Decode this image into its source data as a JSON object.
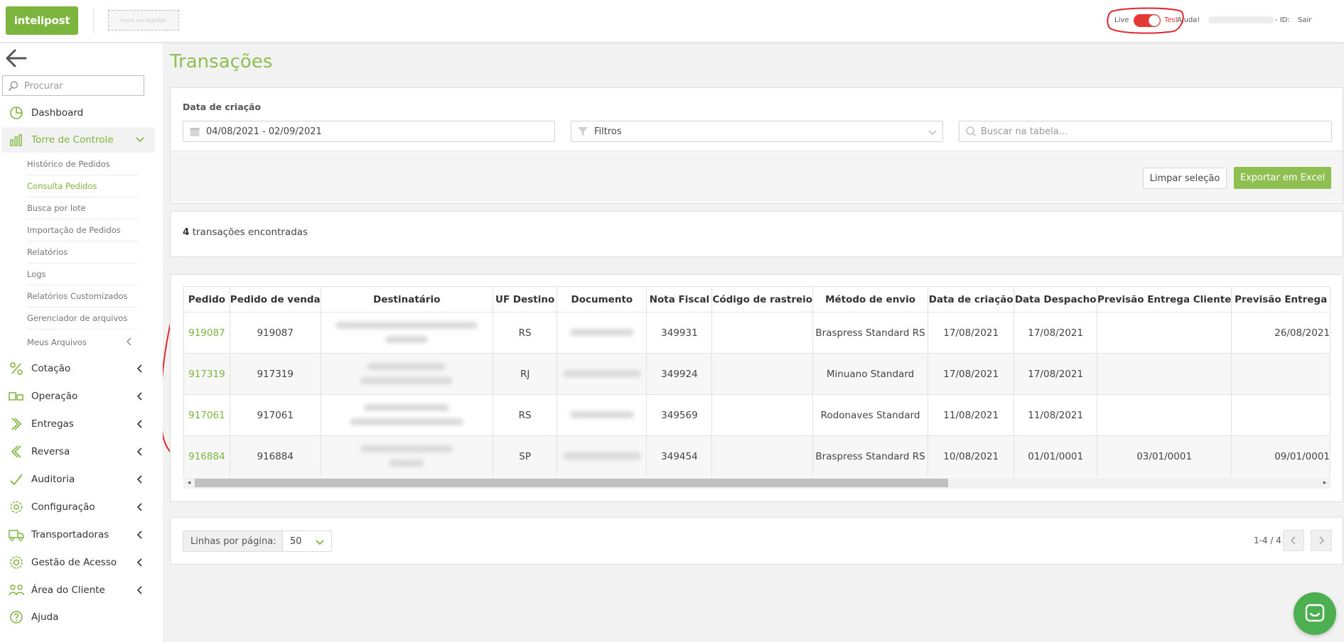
{
  "header": {
    "logo_text": "intelipost",
    "logo_placeholder": "Insira seu logotipo",
    "env_live": "Live",
    "env_test": "Test",
    "help": "Ajuda!",
    "id_label": "- ID:",
    "logout": "Sair"
  },
  "sidebar": {
    "search_placeholder": "Procurar",
    "items": [
      {
        "label": "Dashboard",
        "icon": "pie-chart-icon"
      },
      {
        "label": "Torre de Controle",
        "icon": "bar-chart-icon"
      },
      {
        "label": "Cotação",
        "icon": "percent-icon"
      },
      {
        "label": "Operação",
        "icon": "truck-box-icon"
      },
      {
        "label": "Entregas",
        "icon": "chevrons-right-icon"
      },
      {
        "label": "Reversa",
        "icon": "chevrons-left-icon"
      },
      {
        "label": "Auditoria",
        "icon": "checkmark-icon"
      },
      {
        "label": "Configuração",
        "icon": "gear-icon"
      },
      {
        "label": "Transportadoras",
        "icon": "truck-icon"
      },
      {
        "label": "Gestão de Acesso",
        "icon": "cog-lock-icon"
      },
      {
        "label": "Área do Cliente",
        "icon": "users-icon"
      },
      {
        "label": "Ajuda",
        "icon": "question-icon"
      }
    ],
    "subitems": [
      "Histórico de Pedidos",
      "Consulta Pedidos",
      "Busca por lote",
      "Importação de Pedidos",
      "Relatórios",
      "Logs",
      "Relatórios Customizados",
      "Gerenciador de arquivos",
      "Meus Arquivos"
    ]
  },
  "page": {
    "title": "Transações",
    "filters": {
      "label": "Data de criação",
      "date_range": "04/08/2021 - 02/09/2021",
      "filters_placeholder": "Filtros",
      "search_placeholder": "Buscar na tabela..."
    },
    "buttons": {
      "clear": "Limpar seleção",
      "export": "Exportar em Excel"
    },
    "results": {
      "count": "4",
      "suffix": " transações encontradas"
    },
    "table": {
      "columns": [
        "Pedido",
        "Pedido de venda",
        "Destinatário",
        "UF Destino",
        "Documento",
        "Nota Fiscal",
        "Código de rastreio",
        "Método de envio",
        "Data de criação",
        "Data Despacho",
        "Previsão Entrega Cliente",
        "Previsão Entrega"
      ],
      "rows": [
        {
          "pedido": "919087",
          "venda": "919087",
          "uf": "RS",
          "nf": "349931",
          "rastreio": "",
          "metodo": "Braspress Standard RS",
          "criacao": "17/08/2021",
          "despacho": "17/08/2021",
          "prev_cliente": "",
          "prev": "26/08/2021"
        },
        {
          "pedido": "917319",
          "venda": "917319",
          "uf": "RJ",
          "nf": "349924",
          "rastreio": "",
          "metodo": "Minuano Standard",
          "criacao": "17/08/2021",
          "despacho": "17/08/2021",
          "prev_cliente": "",
          "prev": ""
        },
        {
          "pedido": "917061",
          "venda": "917061",
          "uf": "RS",
          "nf": "349569",
          "rastreio": "",
          "metodo": "Rodonaves Standard",
          "criacao": "11/08/2021",
          "despacho": "11/08/2021",
          "prev_cliente": "",
          "prev": ""
        },
        {
          "pedido": "916884",
          "venda": "916884",
          "uf": "SP",
          "nf": "349454",
          "rastreio": "",
          "metodo": "Braspress Standard RS",
          "criacao": "10/08/2021",
          "despacho": "01/01/0001",
          "prev_cliente": "03/01/0001",
          "prev": "09/01/0001"
        }
      ]
    },
    "pagination": {
      "rows_label": "Linhas por página:",
      "rows_value": "50",
      "info": "1-4 / 4"
    }
  },
  "colors": {
    "brand_green": "#7cb53d",
    "title_green": "#8dc050",
    "toggle_red": "#e53935",
    "annotation_red": "#e0282e"
  }
}
